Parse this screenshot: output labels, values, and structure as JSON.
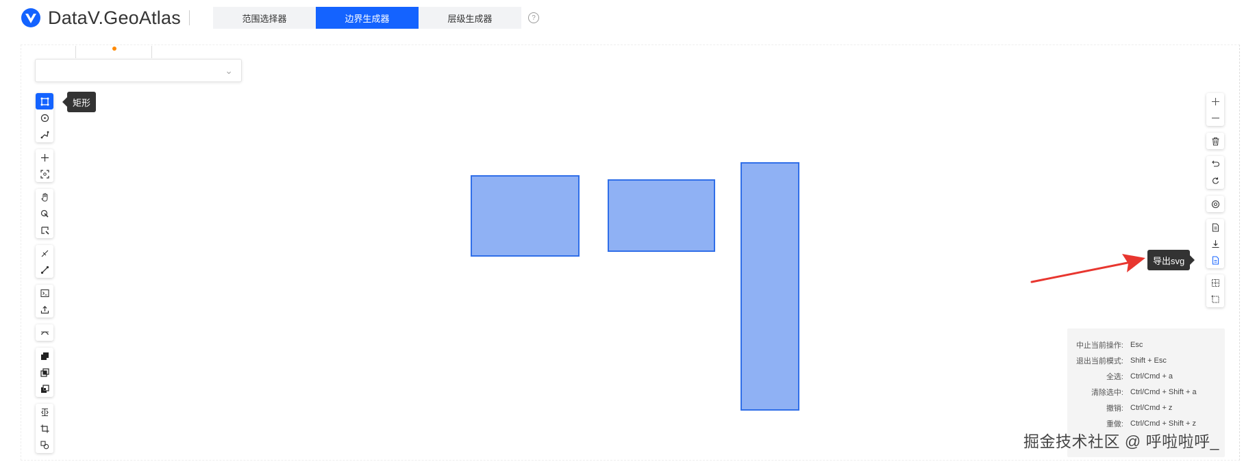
{
  "header": {
    "app_title": "DataV.GeoAtlas",
    "tabs": [
      {
        "label": "范围选择器",
        "active": false
      },
      {
        "label": "边界生成器",
        "active": true
      },
      {
        "label": "层级生成器",
        "active": false
      }
    ],
    "help_icon": "?"
  },
  "map": {
    "region_select_value": "",
    "left_toolbar": [
      {
        "group": 1,
        "tools": [
          "rectangle-icon",
          "circle-icon",
          "polyline-draw-icon"
        ]
      },
      {
        "group": 2,
        "tools": [
          "move-icon",
          "fit-view-icon"
        ]
      },
      {
        "group": 3,
        "tools": [
          "hand-pan-icon",
          "point-edit-icon",
          "select-box-icon"
        ]
      },
      {
        "group": 4,
        "tools": [
          "line-cut-icon",
          "line-icon"
        ]
      },
      {
        "group": 5,
        "tools": [
          "console-icon",
          "upload-icon"
        ]
      },
      {
        "group": 6,
        "tools": [
          "curve-icon"
        ]
      },
      {
        "group": 7,
        "tools": [
          "union-icon",
          "intersect-icon",
          "difference-icon"
        ]
      },
      {
        "group": 8,
        "tools": [
          "split-icon",
          "crop-icon",
          "merge-icon"
        ]
      }
    ],
    "right_toolbar": [
      {
        "group": 1,
        "tools": [
          "zoom-in-icon",
          "zoom-out-icon"
        ]
      },
      {
        "group": 2,
        "tools": [
          "delete-icon"
        ]
      },
      {
        "group": 3,
        "tools": [
          "undo-icon",
          "redo-icon"
        ]
      },
      {
        "group": 4,
        "tools": [
          "locate-icon"
        ]
      },
      {
        "group": 5,
        "tools": [
          "export-file-icon",
          "download-icon",
          "export-svg-icon"
        ]
      },
      {
        "group": 6,
        "tools": [
          "grid-select-icon",
          "bbox-icon"
        ]
      }
    ],
    "tooltip_left": "矩形",
    "tooltip_right": "导出svg",
    "accent_color": "#1463ff",
    "shape_fill": "#8fb1f4",
    "shape_stroke": "#2f6ee8",
    "arrow_color": "#e8362f"
  },
  "shortcuts": [
    {
      "key": "中止当前操作:",
      "value": "Esc"
    },
    {
      "key": "退出当前模式:",
      "value": "Shift + Esc"
    },
    {
      "key": "全选:",
      "value": "Ctrl/Cmd + a"
    },
    {
      "key": "清除选中:",
      "value": "Ctrl/Cmd + Shift + a"
    },
    {
      "key": "撤销:",
      "value": "Ctrl/Cmd + z"
    },
    {
      "key": "重做:",
      "value": "Ctrl/Cmd + Shift + z"
    }
  ],
  "watermark": "掘金技术社区 @ 呼啦啦呼_"
}
